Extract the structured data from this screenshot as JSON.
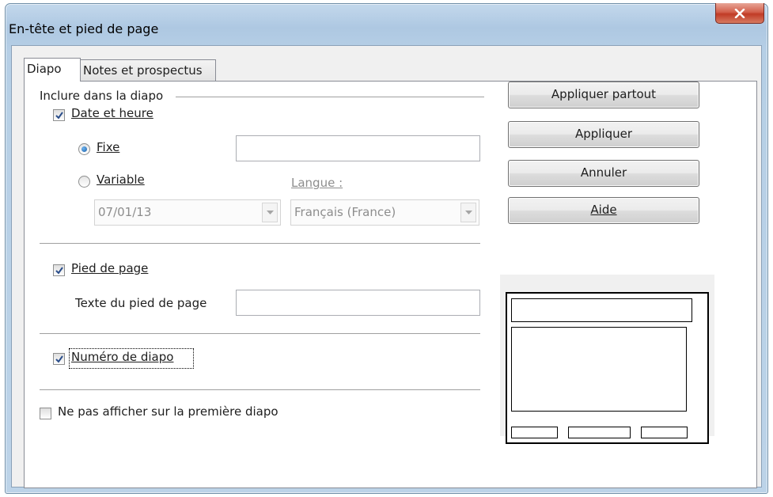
{
  "window": {
    "title": "En-tête et pied de page",
    "close_label": "x"
  },
  "tabs": [
    {
      "label": "Diapo",
      "active": true
    },
    {
      "label": "Notes et prospectus",
      "active": false
    }
  ],
  "include_section": {
    "title": "Inclure dans la diapo"
  },
  "date_time": {
    "label": "Date et heure",
    "checked": true,
    "fixed": {
      "label": "Fixe",
      "selected": true,
      "value": ""
    },
    "variable": {
      "label": "Variable",
      "selected": false,
      "format_value": "07/01/13",
      "language_label": "Langue :",
      "language_value": "Français (France)"
    }
  },
  "footer": {
    "label": "Pied de page",
    "checked": true,
    "text_label": "Texte du pied de page",
    "text_value": ""
  },
  "slide_number": {
    "label": "Numéro de diapo",
    "checked": true
  },
  "hide_first": {
    "label": "Ne pas afficher sur la première diapo",
    "checked": false
  },
  "buttons": {
    "apply_all": "Appliquer partout",
    "apply": "Appliquer",
    "cancel": "Annuler",
    "help": "Aide"
  },
  "icons": {
    "close": "close-icon",
    "check": "check-icon",
    "dropdown": "chevron-down-icon"
  },
  "colors": {
    "title_bar": "#aec8e2",
    "close_button": "#c03b26",
    "check_mark": "#2a4d8a",
    "radio_dot": "#1a5fa8"
  }
}
